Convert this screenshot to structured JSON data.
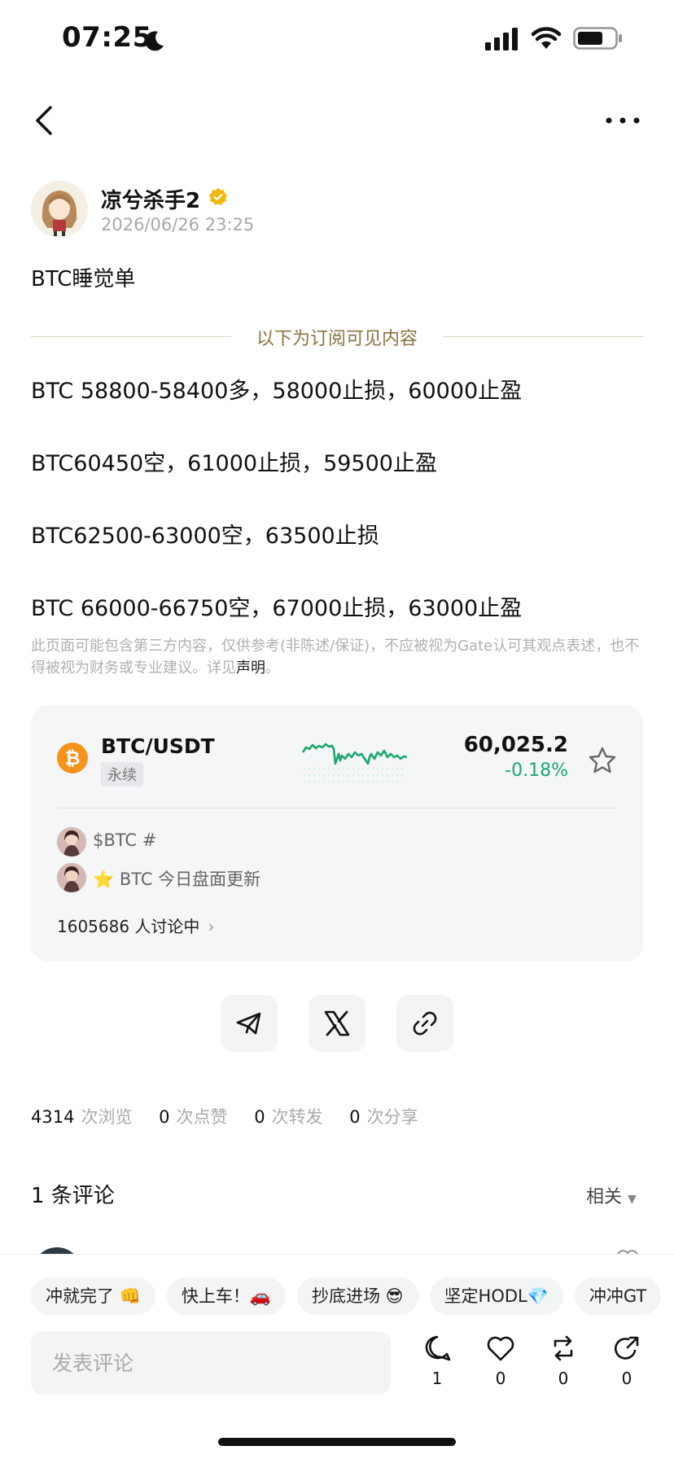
{
  "status_bar": {
    "time": "07:25"
  },
  "author": {
    "name": "凉兮杀手2",
    "time": "2026/06/26 23:25"
  },
  "post": {
    "title": "BTC睡觉单",
    "divider_label": "以下为订阅可见内容",
    "lines": [
      "BTC 58800-58400多，58000止损，60000止盈",
      "BTC60450空，61000止损，59500止盈",
      "BTC62500-63000空，63500止损",
      "BTC 66000-66750空，67000止损，63000止盈"
    ],
    "disclaimer": "此页面可能包含第三方内容，仅供参考(非陈述/保证)，不应被视为Gate认可其观点表述，也不得被视为财务或专业建议。详见",
    "disclaimer_link": "声明",
    "disclaimer_end": "。"
  },
  "ticker": {
    "pair": "BTC/USDT",
    "tag": "永续",
    "price": "60,025.2",
    "change": "-0.18%",
    "change_color": "#1aa86b",
    "topics": [
      "$BTC #",
      "⭐ BTC 今日盘面更新"
    ],
    "discussion": "1605686 人讨论中"
  },
  "share": [
    "telegram-icon",
    "x-icon",
    "link-icon"
  ],
  "stats": [
    {
      "num": "4314",
      "label": "次浏览"
    },
    {
      "num": "0",
      "label": "次点赞"
    },
    {
      "num": "0",
      "label": "次转发"
    },
    {
      "num": "0",
      "label": "次分享"
    }
  ],
  "comments": {
    "heading": "1 条评论",
    "sort": "相关"
  },
  "quick_replies": [
    "冲就完了 👊",
    "快上车！🚗",
    "抄底进场 😎",
    "坚定HODL💎",
    "冲冲GT"
  ],
  "comment_input": {
    "placeholder": "发表评论"
  },
  "actions": [
    {
      "icon": "comment-icon",
      "count": "1"
    },
    {
      "icon": "heart-icon",
      "count": "0"
    },
    {
      "icon": "repost-icon",
      "count": "0"
    },
    {
      "icon": "share-icon",
      "count": "0"
    }
  ],
  "colors": {
    "accent_gold": "#8a7343",
    "btc_orange": "#f7931a",
    "up_green": "#1aa86b"
  }
}
